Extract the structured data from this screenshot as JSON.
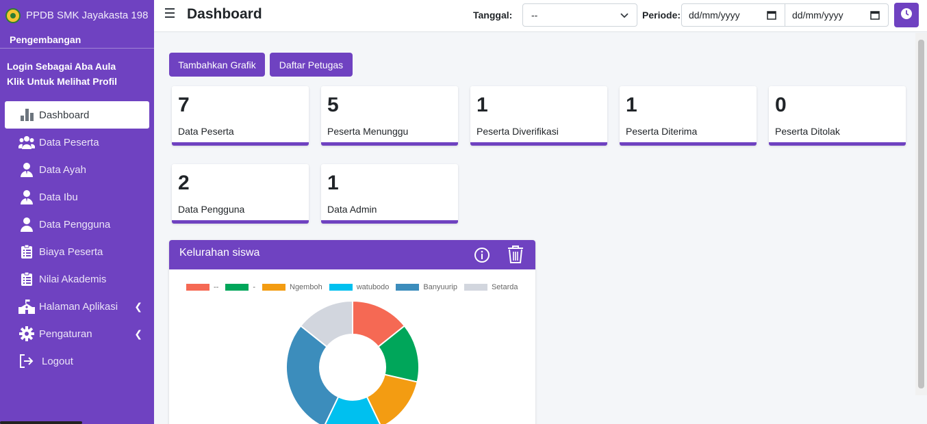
{
  "app": {
    "brand": "PPDB SMK Jayakasta 198",
    "sub_brand": "Pengembangan",
    "login_prefix": "Login Sebagai ",
    "user_name": "Aba Aula",
    "profile_link": "Klik Untuk Melihat Profil"
  },
  "sidebar": {
    "items": [
      {
        "label": "Dashboard",
        "icon": "bar-chart-icon"
      },
      {
        "label": "Data Peserta",
        "icon": "users-icon"
      },
      {
        "label": "Data Ayah",
        "icon": "user-tie-icon"
      },
      {
        "label": "Data Ibu",
        "icon": "user-tie-icon"
      },
      {
        "label": "Data Pengguna",
        "icon": "user-icon"
      },
      {
        "label": "Biaya Peserta",
        "icon": "clipboard-list-icon"
      },
      {
        "label": "Nilai Akademis",
        "icon": "clipboard-list-icon"
      },
      {
        "label": "Halaman Aplikasi",
        "icon": "school-icon"
      },
      {
        "label": "Pengaturan",
        "icon": "gear-icon"
      },
      {
        "label": "Logout",
        "icon": "logout-icon"
      }
    ]
  },
  "header": {
    "title": "Dashboard",
    "tanggal_label": "Tanggal:",
    "tanggal_value": "--",
    "periode_label": "Periode:",
    "date_from_placeholder": "dd/mm/yyyy",
    "date_to_placeholder": "dd/mm/yyyy"
  },
  "actions": {
    "add_chart": "Tambahkan Grafik",
    "officer_list": "Daftar Petugas"
  },
  "stats": [
    {
      "value": "7",
      "label": "Data Peserta"
    },
    {
      "value": "5",
      "label": "Peserta Menunggu"
    },
    {
      "value": "1",
      "label": "Peserta Diverifikasi"
    },
    {
      "value": "1",
      "label": "Peserta Diterima"
    },
    {
      "value": "0",
      "label": "Peserta Ditolak"
    },
    {
      "value": "2",
      "label": "Data Pengguna"
    },
    {
      "value": "1",
      "label": "Data Admin"
    }
  ],
  "colors": {
    "accent": "#6f42c1"
  },
  "chart_data": {
    "type": "pie",
    "title": "Kelurahan siswa",
    "categories": [
      "--",
      "-",
      "Ngemboh",
      "watubodo",
      "Banyuurip",
      "Setarda"
    ],
    "values": [
      1,
      1,
      1,
      1,
      2,
      1
    ],
    "colors": [
      "#f56954",
      "#00a65a",
      "#f39c12",
      "#00c0ef",
      "#3c8dbc",
      "#d2d6de"
    ],
    "legend": "top"
  }
}
